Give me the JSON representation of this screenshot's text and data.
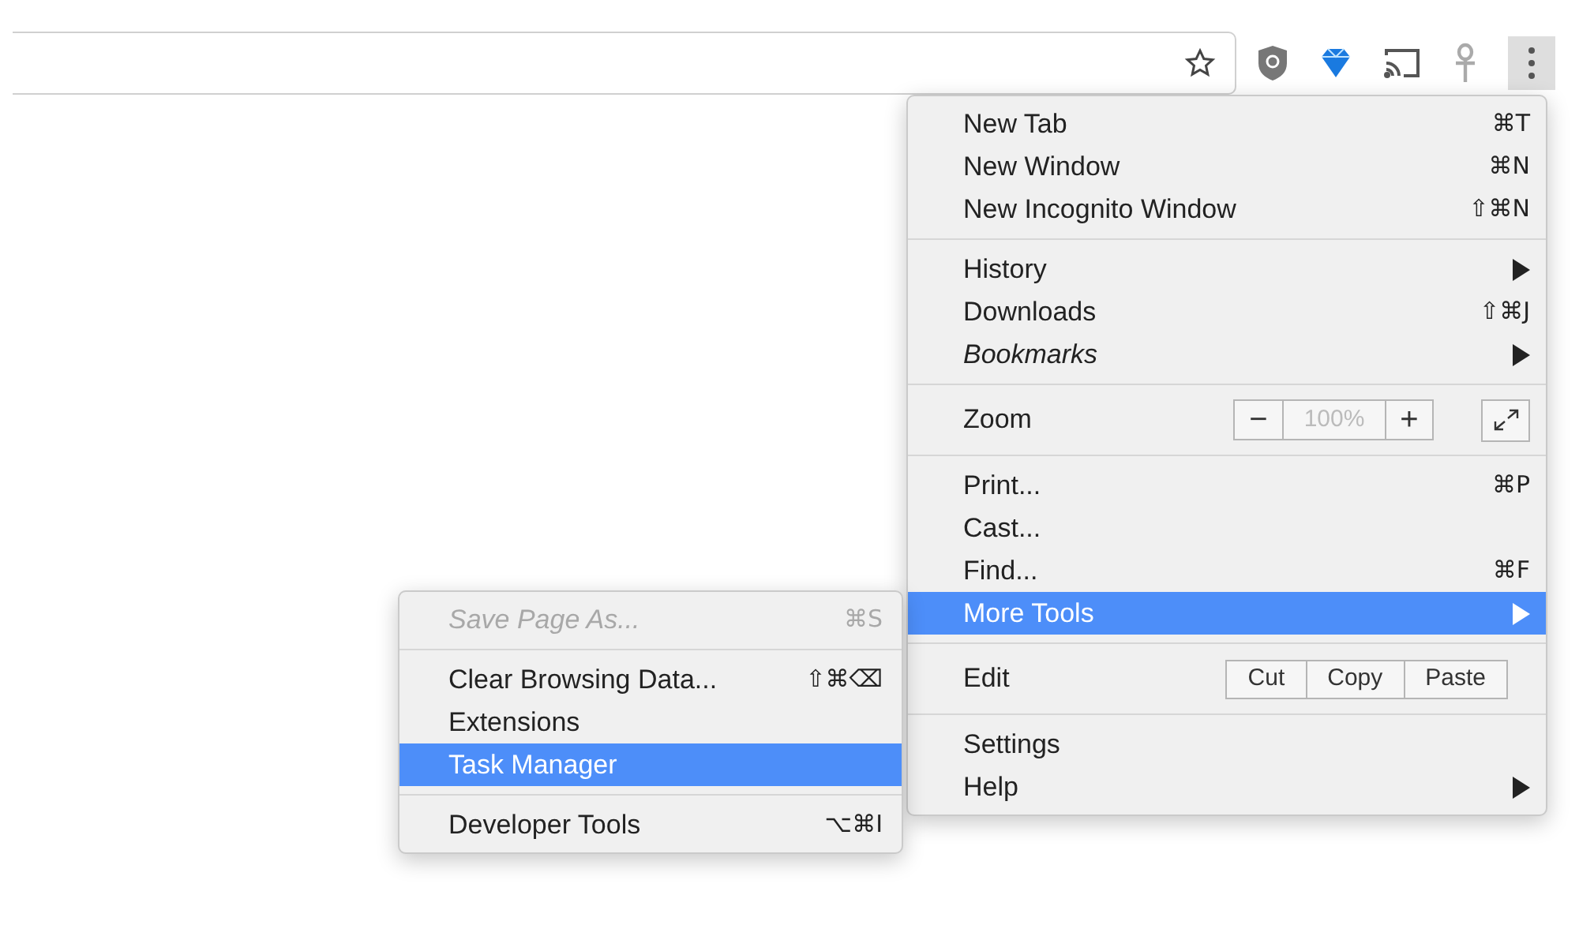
{
  "main_menu": {
    "sections": [
      [
        {
          "kind": "item",
          "label": "New Tab",
          "shortcut": "⌘T",
          "submenu": false,
          "selected": false,
          "disabled": false
        },
        {
          "kind": "item",
          "label": "New Window",
          "shortcut": "⌘N",
          "submenu": false,
          "selected": false,
          "disabled": false
        },
        {
          "kind": "item",
          "label": "New Incognito Window",
          "shortcut": "⇧⌘N",
          "submenu": false,
          "selected": false,
          "disabled": false
        }
      ],
      [
        {
          "kind": "item",
          "label": "History",
          "submenu": true,
          "selected": false,
          "disabled": false
        },
        {
          "kind": "item",
          "label": "Downloads",
          "shortcut": "⇧⌘J",
          "submenu": false,
          "selected": false,
          "disabled": false
        },
        {
          "kind": "item",
          "label": "Bookmarks",
          "italic": true,
          "submenu": true,
          "selected": false,
          "disabled": false
        }
      ],
      [
        {
          "kind": "zoom",
          "label": "Zoom",
          "minus": "−",
          "value": "100%",
          "plus": "+"
        }
      ],
      [
        {
          "kind": "item",
          "label": "Print...",
          "shortcut": "⌘P",
          "submenu": false,
          "selected": false,
          "disabled": false
        },
        {
          "kind": "item",
          "label": "Cast...",
          "submenu": false,
          "selected": false,
          "disabled": false
        },
        {
          "kind": "item",
          "label": "Find...",
          "shortcut": "⌘F",
          "submenu": false,
          "selected": false,
          "disabled": false
        },
        {
          "kind": "item",
          "label": "More Tools",
          "submenu": true,
          "selected": true,
          "disabled": false
        }
      ],
      [
        {
          "kind": "edit",
          "label": "Edit",
          "buttons": [
            "Cut",
            "Copy",
            "Paste"
          ]
        }
      ],
      [
        {
          "kind": "item",
          "label": "Settings",
          "submenu": false,
          "selected": false,
          "disabled": false
        },
        {
          "kind": "item",
          "label": "Help",
          "submenu": true,
          "selected": false,
          "disabled": false
        }
      ]
    ]
  },
  "more_tools_menu": {
    "sections": [
      [
        {
          "kind": "item",
          "label": "Save Page As...",
          "shortcut": "⌘S",
          "submenu": false,
          "selected": false,
          "disabled": true
        }
      ],
      [
        {
          "kind": "item",
          "label": "Clear Browsing Data...",
          "shortcut": "⇧⌘⌫",
          "submenu": false,
          "selected": false,
          "disabled": false
        },
        {
          "kind": "item",
          "label": "Extensions",
          "submenu": false,
          "selected": false,
          "disabled": false
        },
        {
          "kind": "item",
          "label": "Task Manager",
          "submenu": false,
          "selected": true,
          "disabled": false
        }
      ],
      [
        {
          "kind": "item",
          "label": "Developer Tools",
          "shortcut": "⌥⌘I",
          "submenu": false,
          "selected": false,
          "disabled": false
        }
      ]
    ]
  }
}
